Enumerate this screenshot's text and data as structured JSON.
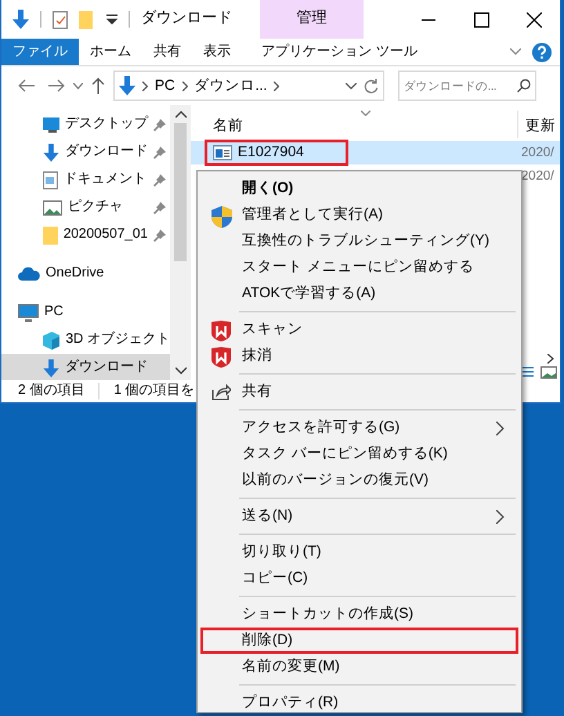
{
  "window": {
    "title": "ダウンロード",
    "context_tab": "管理"
  },
  "ribbon_tabs": [
    {
      "label": "ファイル",
      "selected": true
    },
    {
      "label": "ホーム",
      "selected": false
    },
    {
      "label": "共有",
      "selected": false
    },
    {
      "label": "表示",
      "selected": false
    },
    {
      "label": "アプリケーション ツール",
      "selected": false
    }
  ],
  "address": {
    "path": [
      "PC",
      "ダウンロ..."
    ],
    "search_placeholder": "ダウンロードの..."
  },
  "sidebar": {
    "items": [
      {
        "label": "デスクトップ",
        "kind": "desktop",
        "pinned": true,
        "selected": false
      },
      {
        "label": "ダウンロード",
        "kind": "download",
        "pinned": true,
        "selected": false
      },
      {
        "label": "ドキュメント",
        "kind": "document",
        "pinned": true,
        "selected": false
      },
      {
        "label": "ピクチャ",
        "kind": "picture",
        "pinned": true,
        "selected": false
      },
      {
        "label": "20200507_01",
        "kind": "folder",
        "pinned": true,
        "selected": false
      },
      {
        "label": "OneDrive",
        "kind": "cloud",
        "pinned": false,
        "selected": false
      },
      {
        "label": "PC",
        "kind": "pc",
        "pinned": false,
        "selected": false,
        "children": [
          {
            "label": "3D オブジェクト",
            "kind": "cube",
            "pinned": false,
            "selected": false
          },
          {
            "label": "ダウンロード",
            "kind": "download",
            "pinned": false,
            "selected": true
          }
        ]
      }
    ]
  },
  "file_list": {
    "columns": [
      "名前",
      "更新"
    ],
    "rows": [
      {
        "name": "E1027904",
        "date": "2020/",
        "selected": true,
        "highlighted": true
      },
      {
        "date": "2020/",
        "selected": false
      }
    ]
  },
  "status_bar": [
    "2 個の項目",
    "1 個の項目を"
  ],
  "context_menu": [
    {
      "kind": "item",
      "label": "開く(O)",
      "bold": true,
      "highlighted": false
    },
    {
      "kind": "shield_item",
      "label": "管理者として実行(A)",
      "highlighted": false
    },
    {
      "kind": "item",
      "label": "互換性のトラブルシューティング(Y)",
      "highlighted": false
    },
    {
      "kind": "item",
      "label": "スタート メニューにピン留めする",
      "highlighted": false
    },
    {
      "kind": "item",
      "label": "ATOKで学習する(A)",
      "highlighted": false
    },
    {
      "kind": "separator"
    },
    {
      "kind": "antivirus_item",
      "label": "スキャン",
      "highlighted": false
    },
    {
      "kind": "antivirus_item",
      "label": "抹消",
      "highlighted": false
    },
    {
      "kind": "separator"
    },
    {
      "kind": "share_item",
      "label": "共有",
      "highlighted": false
    },
    {
      "kind": "separator"
    },
    {
      "kind": "item",
      "label": "アクセスを許可する(G)",
      "submenu": true,
      "highlighted": false
    },
    {
      "kind": "item",
      "label": "タスク バーにピン留めする(K)",
      "highlighted": false
    },
    {
      "kind": "item",
      "label": "以前のバージョンの復元(V)",
      "highlighted": false
    },
    {
      "kind": "separator"
    },
    {
      "kind": "item",
      "label": "送る(N)",
      "submenu": true,
      "highlighted": false
    },
    {
      "kind": "separator"
    },
    {
      "kind": "item",
      "label": "切り取り(T)",
      "highlighted": false
    },
    {
      "kind": "item",
      "label": "コピー(C)",
      "highlighted": false
    },
    {
      "kind": "separator"
    },
    {
      "kind": "item",
      "label": "ショートカットの作成(S)",
      "highlighted": false
    },
    {
      "kind": "item",
      "label": "削除(D)",
      "highlighted": true
    },
    {
      "kind": "item",
      "label": "名前の変更(M)",
      "highlighted": false
    },
    {
      "kind": "separator"
    },
    {
      "kind": "item",
      "label": "プロパティ(R)",
      "highlighted": false
    }
  ]
}
